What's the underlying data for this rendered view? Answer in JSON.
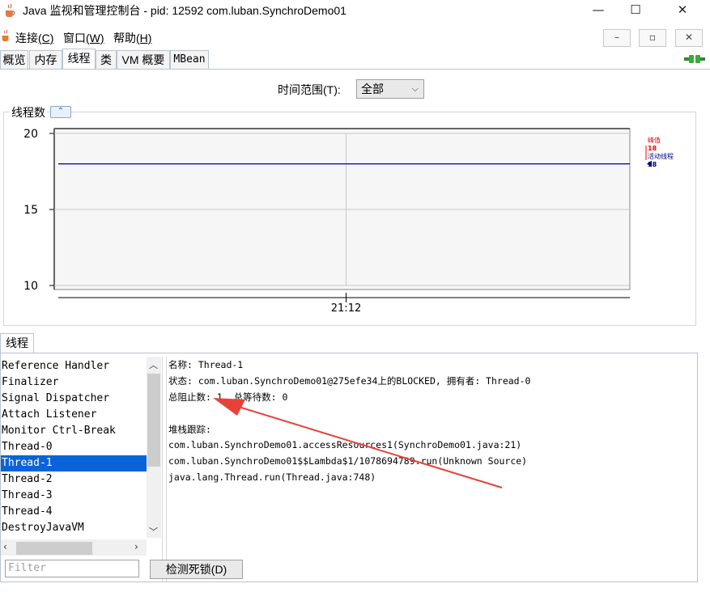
{
  "window": {
    "title": "Java 监视和管理控制台 - pid: 12592 com.luban.SynchroDemo01",
    "minimize": "—",
    "maximize": "☐",
    "close": "✕"
  },
  "menubar": {
    "items": [
      {
        "label": "连接",
        "mnemonic": "(C)"
      },
      {
        "label": "窗口",
        "mnemonic": "(W)"
      },
      {
        "label": "帮助",
        "mnemonic": "(H)"
      }
    ],
    "mdi_minimize": "–",
    "mdi_restore": "▫",
    "mdi_close": "✕"
  },
  "tabs": [
    {
      "label": "概览"
    },
    {
      "label": "内存"
    },
    {
      "label": "线程"
    },
    {
      "label": "类"
    },
    {
      "label": "VM 概要"
    },
    {
      "label": "MBean"
    }
  ],
  "active_tab": "线程",
  "time_range": {
    "label": "时间范围(T):",
    "selected": "全部"
  },
  "thread_count_panel": {
    "title": "线程数",
    "collapse_icon": "chevron-up-icon"
  },
  "chart_data": {
    "type": "line",
    "yticks": [
      "20",
      "15",
      "10"
    ],
    "ylim": [
      10,
      20
    ],
    "xticks": [
      "21:12"
    ],
    "series": [
      {
        "name": "峰值",
        "value": 18,
        "color": "#ff0000"
      },
      {
        "name": "活动线程",
        "value": 18,
        "color": "#000080"
      }
    ],
    "legend_placement": "right",
    "grid": true
  },
  "threads_section": {
    "tab_label": "线程",
    "items": [
      "Reference Handler",
      "Finalizer",
      "Signal Dispatcher",
      "Attach Listener",
      "Monitor Ctrl-Break",
      "Thread-0",
      "Thread-1",
      "Thread-2",
      "Thread-3",
      "Thread-4",
      "DestroyJavaVM"
    ],
    "selected": "Thread-1",
    "filter_placeholder": "Filter",
    "detect_button": "检测死锁(D)"
  },
  "details": {
    "name_line": "名称: Thread-1",
    "state_line": "状态: com.luban.SynchroDemo01@275efe34上的BLOCKED, 拥有者: Thread-0",
    "blocked_line": "总阻止数: 1, 总等待数: 0",
    "stack_title": "堆栈跟踪:",
    "stack": [
      "com.luban.SynchroDemo01.accessResources1(SynchroDemo01.java:21)",
      "com.luban.SynchroDemo01$$Lambda$1/1078694789.run(Unknown Source)",
      "java.lang.Thread.run(Thread.java:748)"
    ]
  },
  "colors": {
    "selection": "#0a64d8",
    "annotation_arrow": "#e8413a",
    "active_series": "#000080",
    "peak_series": "#ff0000"
  }
}
